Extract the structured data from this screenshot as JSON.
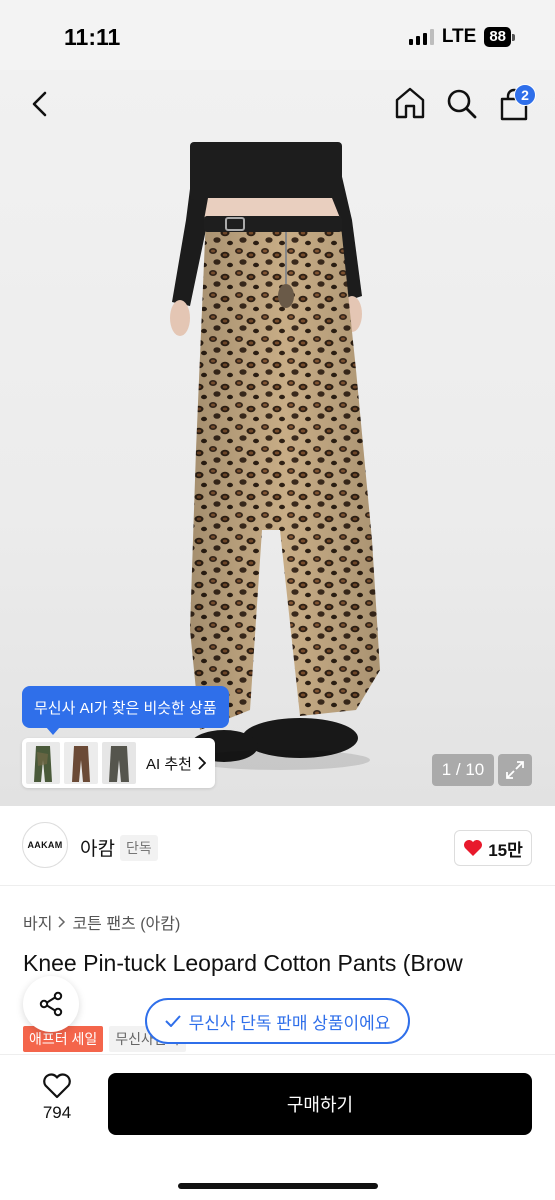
{
  "status_bar": {
    "time": "11:11",
    "network": "LTE",
    "battery": "88"
  },
  "header": {
    "cart_count": "2",
    "icons": [
      "back-icon",
      "home-icon",
      "search-icon",
      "bag-icon"
    ]
  },
  "hero": {
    "ai_tooltip": "무신사 AI가 찾은 비슷한 상품",
    "ai_recommend_label": "AI 추천",
    "image_counter": "1 / 10"
  },
  "brand": {
    "logo_text": "AAKAM",
    "name": "아캄",
    "tag": "단독",
    "like_count": "15만"
  },
  "breadcrumb": {
    "category": "바지",
    "subcategory": "코튼 팬츠 (아캄)"
  },
  "product": {
    "title": "Knee Pin-tuck Leopard Cotton Pants (Brow",
    "tags": [
      "애프터 세일",
      "무신사단독"
    ],
    "exclusive_notice": "무신사 단독 판매 상품이에요"
  },
  "bottom_bar": {
    "wish_count": "794",
    "buy_label": "구매하기"
  },
  "colors": {
    "accent_blue": "#2f6fea",
    "sale_red": "#f4654b",
    "heart_red": "#e8192c",
    "buy_button": "#000000"
  }
}
